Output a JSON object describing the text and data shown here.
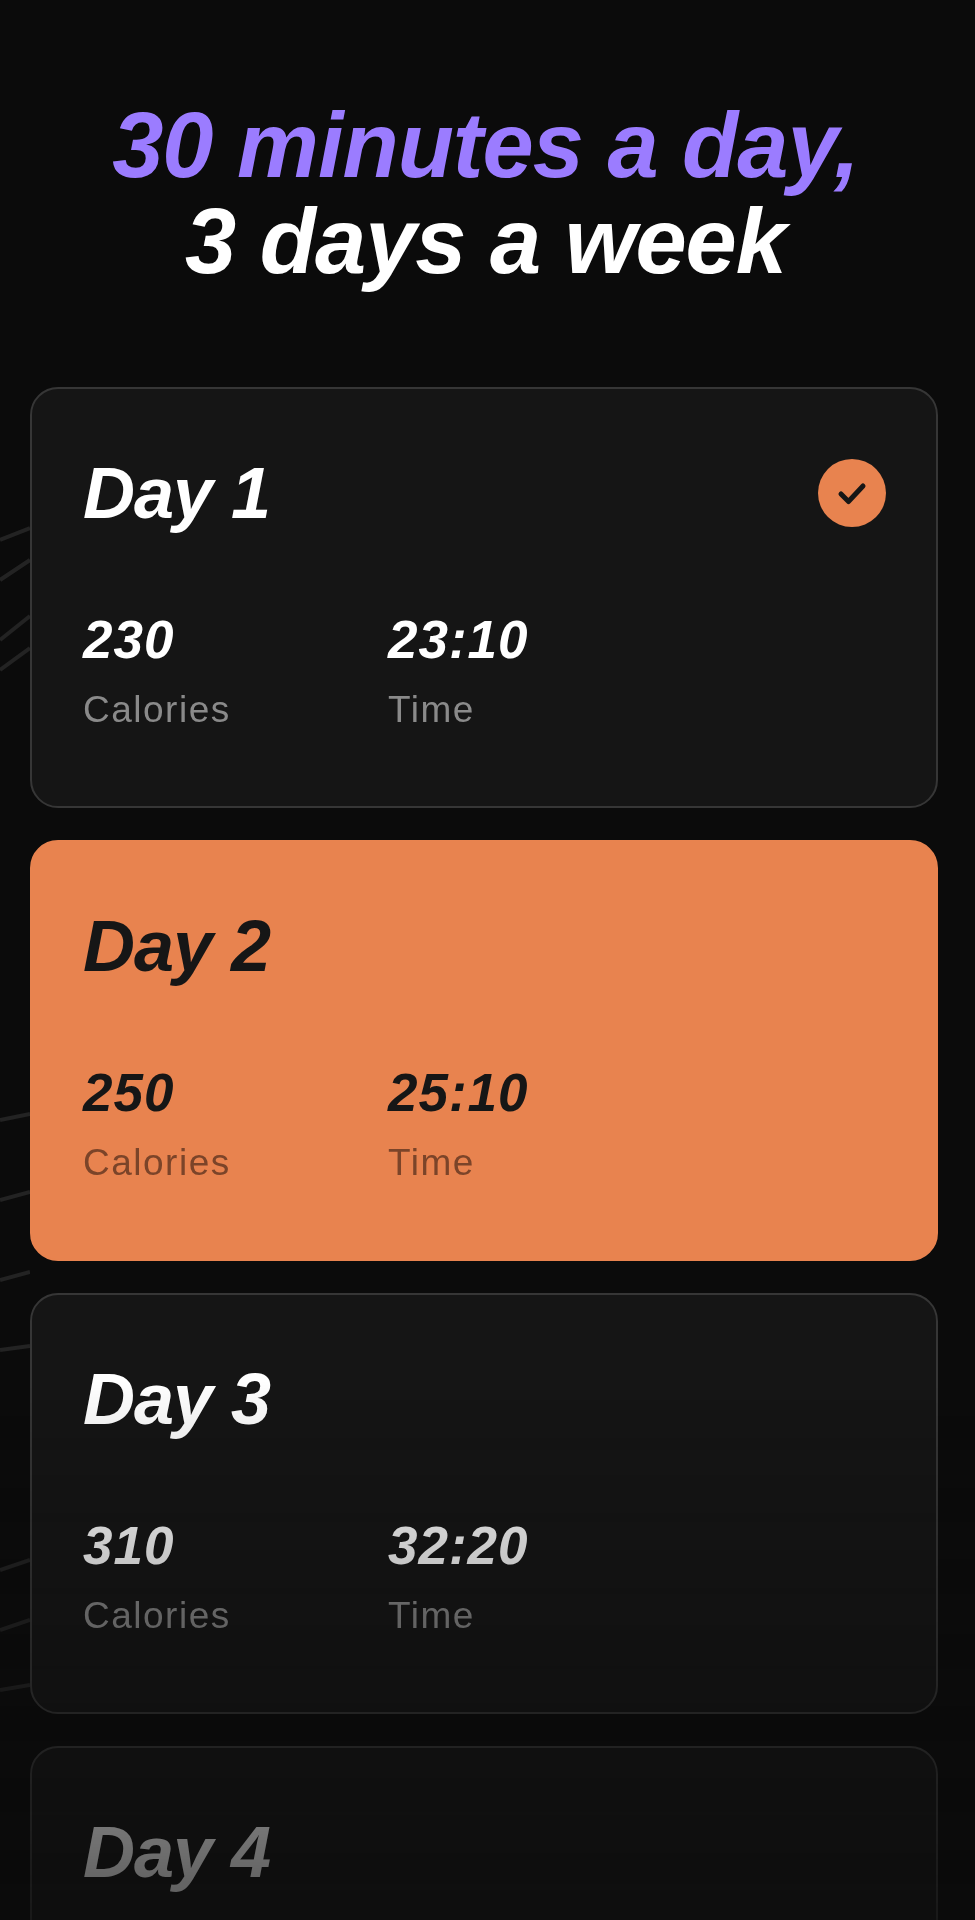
{
  "header": {
    "lines": [
      {
        "text": "30 minutes a day,",
        "color": "#9b7cff"
      },
      {
        "text": "3 days a week",
        "color": "#ffffff"
      }
    ]
  },
  "days": [
    {
      "title": "Day 1",
      "completed": true,
      "selected": false,
      "stats": [
        {
          "value": "230",
          "label": "Calories"
        },
        {
          "value": "23:10",
          "label": "Time"
        }
      ]
    },
    {
      "title": "Day 2",
      "completed": false,
      "selected": true,
      "stats": [
        {
          "value": "250",
          "label": "Calories"
        },
        {
          "value": "25:10",
          "label": "Time"
        }
      ]
    },
    {
      "title": "Day 3",
      "completed": false,
      "selected": false,
      "stats": [
        {
          "value": "310",
          "label": "Calories"
        },
        {
          "value": "32:20",
          "label": "Time"
        }
      ]
    },
    {
      "title": "Day 4",
      "completed": false,
      "selected": false
    }
  ]
}
